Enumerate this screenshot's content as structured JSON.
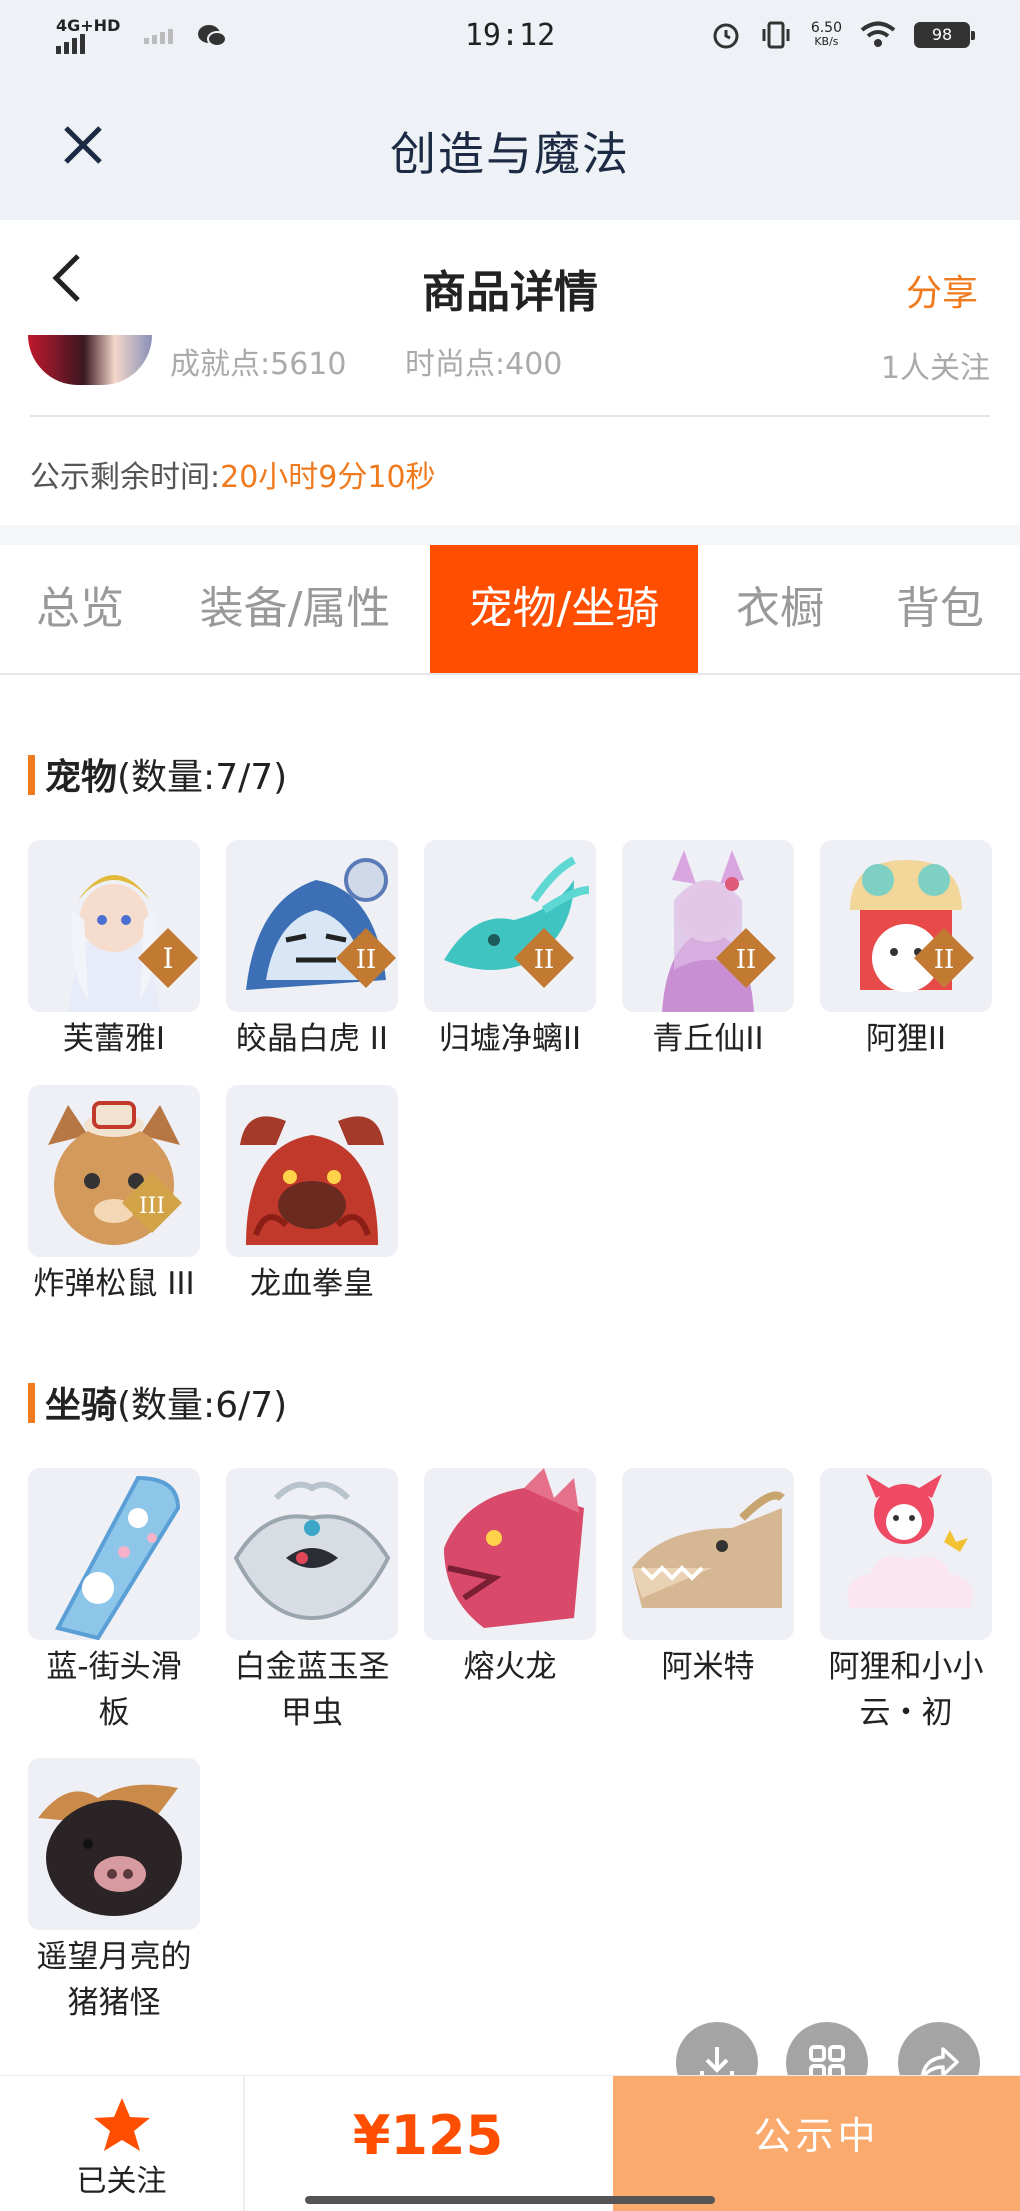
{
  "status_bar": {
    "time": "19:12",
    "network": "4G+HD",
    "speed_top": "6.50",
    "speed_bottom": "KB/s",
    "battery": "98"
  },
  "app_bar": {
    "title": "创造与魔法"
  },
  "page_header": {
    "title": "商品详情",
    "share_label": "分享"
  },
  "account_stats": {
    "achievement": "成就点:5610",
    "fashion": "时尚点:400",
    "followers": "1人关注"
  },
  "publicity": {
    "label": "公示剩余时间:",
    "remaining": "20小时9分10秒"
  },
  "tabs": [
    {
      "label": "总览",
      "active": false
    },
    {
      "label": "装备/属性",
      "active": false
    },
    {
      "label": "宠物/坐骑",
      "active": true
    },
    {
      "label": "衣橱",
      "active": false
    },
    {
      "label": "背包",
      "active": false
    }
  ],
  "pets": {
    "title": "宠物",
    "count": "(数量:7/7)",
    "items": [
      {
        "name": "芙蕾雅I",
        "tier": "I",
        "icon": "goddess-pet-icon"
      },
      {
        "name": "皎晶白虎 II",
        "tier": "II",
        "icon": "white-tiger-pet-icon"
      },
      {
        "name": "归墟净螭II",
        "tier": "II",
        "icon": "jade-dragon-pet-icon"
      },
      {
        "name": "青丘仙II",
        "tier": "II",
        "icon": "fox-fairy-pet-icon"
      },
      {
        "name": "阿狸II",
        "tier": "II",
        "icon": "ali-fox-pet-icon"
      },
      {
        "name": "炸弹松鼠 III",
        "tier": "III",
        "icon": "bomb-squirrel-pet-icon"
      },
      {
        "name": "龙血拳皇",
        "tier": "",
        "icon": "dragon-boxer-pet-icon"
      }
    ]
  },
  "mounts": {
    "title": "坐骑",
    "count": "(数量:6/7)",
    "items": [
      {
        "name": "蓝-街头滑板",
        "line1": "蓝-街头滑",
        "line2": "板",
        "icon": "skateboard-mount-icon"
      },
      {
        "name": "白金蓝玉圣甲虫",
        "line1": "白金蓝玉圣",
        "line2": "甲虫",
        "icon": "scarab-mount-icon"
      },
      {
        "name": "熔火龙",
        "line1": "熔火龙",
        "line2": "",
        "icon": "magma-dragon-mount-icon"
      },
      {
        "name": "阿米特",
        "line1": "阿米特",
        "line2": "",
        "icon": "ammit-mount-icon"
      },
      {
        "name": "阿狸和小小云・初",
        "line1": "阿狸和小小",
        "line2": "云・初",
        "icon": "ali-cloud-mount-icon"
      },
      {
        "name": "遥望月亮的猪猪怪",
        "line1": "遥望月亮的",
        "line2": "猪猪怪",
        "icon": "pig-mount-icon"
      }
    ]
  },
  "floating_actions": [
    {
      "icon": "download-icon"
    },
    {
      "icon": "grid-icon"
    },
    {
      "icon": "share-arrow-icon"
    }
  ],
  "bottom_bar": {
    "follow_label": "已关注",
    "price": "¥125",
    "status_label": "公示中"
  },
  "colors": {
    "accent": "#ff4e00",
    "orange_text": "#f07a1e",
    "status_button": "#fbaa6e"
  }
}
